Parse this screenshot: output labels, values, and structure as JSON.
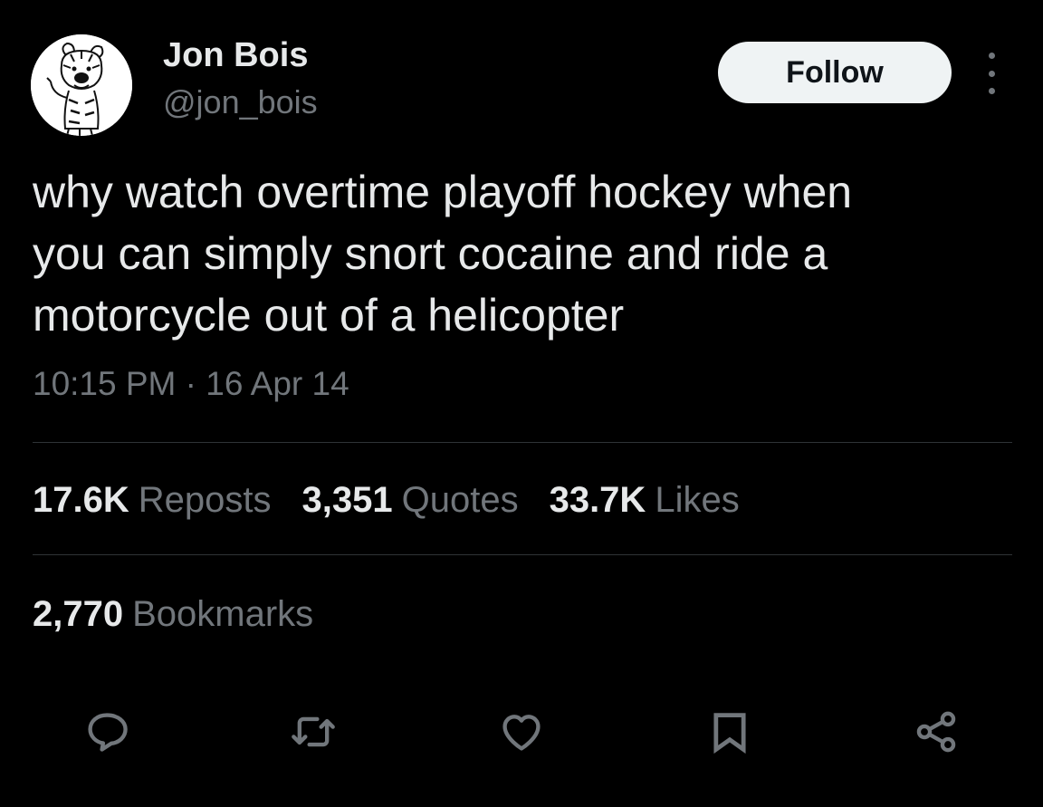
{
  "user": {
    "display_name": "Jon Bois",
    "handle": "@jon_bois"
  },
  "header": {
    "follow_label": "Follow",
    "more_icon": "more-vertical-icon"
  },
  "tweet": {
    "text_lines": [
      "why watch overtime playoff hockey when",
      "you can simply snort cocaine and ride a",
      "motorcycle out of a helicopter"
    ],
    "timestamp": "10:15 PM · 16 Apr 14"
  },
  "stats": {
    "reposts": {
      "count": "17.6K",
      "label": "Reposts"
    },
    "quotes": {
      "count": "3,351",
      "label": "Quotes"
    },
    "likes": {
      "count": "33.7K",
      "label": "Likes"
    },
    "bookmarks": {
      "count": "2,770",
      "label": "Bookmarks"
    }
  },
  "actions": {
    "icons": [
      "reply-icon",
      "repost-icon",
      "like-icon",
      "bookmark-icon",
      "share-icon"
    ]
  },
  "colors": {
    "background": "#000000",
    "primary_text": "#e7e9ea",
    "secondary_text": "#71767b",
    "divider": "#2f3336",
    "follow_bg": "#eff3f4"
  }
}
